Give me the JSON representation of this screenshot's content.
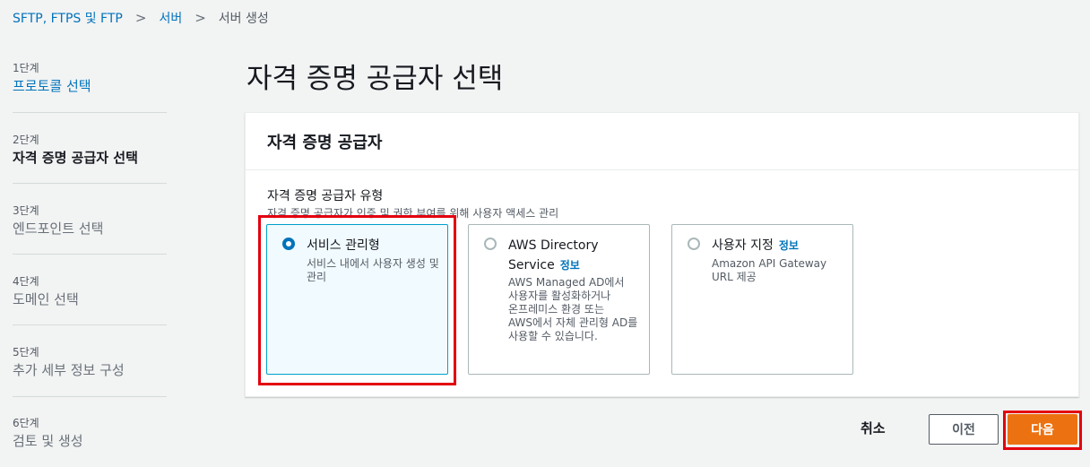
{
  "breadcrumb": {
    "items": [
      "SFTP, FTPS 및 FTP",
      "서버",
      "서버 생성"
    ]
  },
  "steps": [
    {
      "num": "1단계",
      "label": "프로토콜 선택"
    },
    {
      "num": "2단계",
      "label": "자격 증명 공급자 선택"
    },
    {
      "num": "3단계",
      "label": "엔드포인트 선택"
    },
    {
      "num": "4단계",
      "label": "도메인 선택"
    },
    {
      "num": "5단계",
      "label": "추가 세부 정보 구성"
    },
    {
      "num": "6단계",
      "label": "검토 및 생성"
    }
  ],
  "page_title": "자격 증명 공급자 선택",
  "panel": {
    "header": "자격 증명 공급자",
    "field_label": "자격 증명 공급자 유형",
    "field_desc": "자격 증명 공급자가 인증 및 권한 부여를 위해 사용자 액세스 관리",
    "options": [
      {
        "title": "서비스 관리형",
        "info": "",
        "desc": "서비스 내에서 사용자 생성 및 관리",
        "selected": true
      },
      {
        "title": "AWS Directory Service",
        "info": "정보",
        "desc": "AWS Managed AD에서 사용자를 활성화하거나 온프레미스 환경 또는 AWS에서 자체 관리형 AD를 사용할 수 있습니다.",
        "selected": false
      },
      {
        "title": "사용자 지정",
        "info": "정보",
        "desc": "Amazon API Gateway URL 제공",
        "selected": false
      }
    ]
  },
  "footer": {
    "cancel": "취소",
    "previous": "이전",
    "next": "다음"
  },
  "colors": {
    "accent": "#0073bb",
    "primary_button": "#ec7211",
    "highlight": "#e3000f"
  }
}
